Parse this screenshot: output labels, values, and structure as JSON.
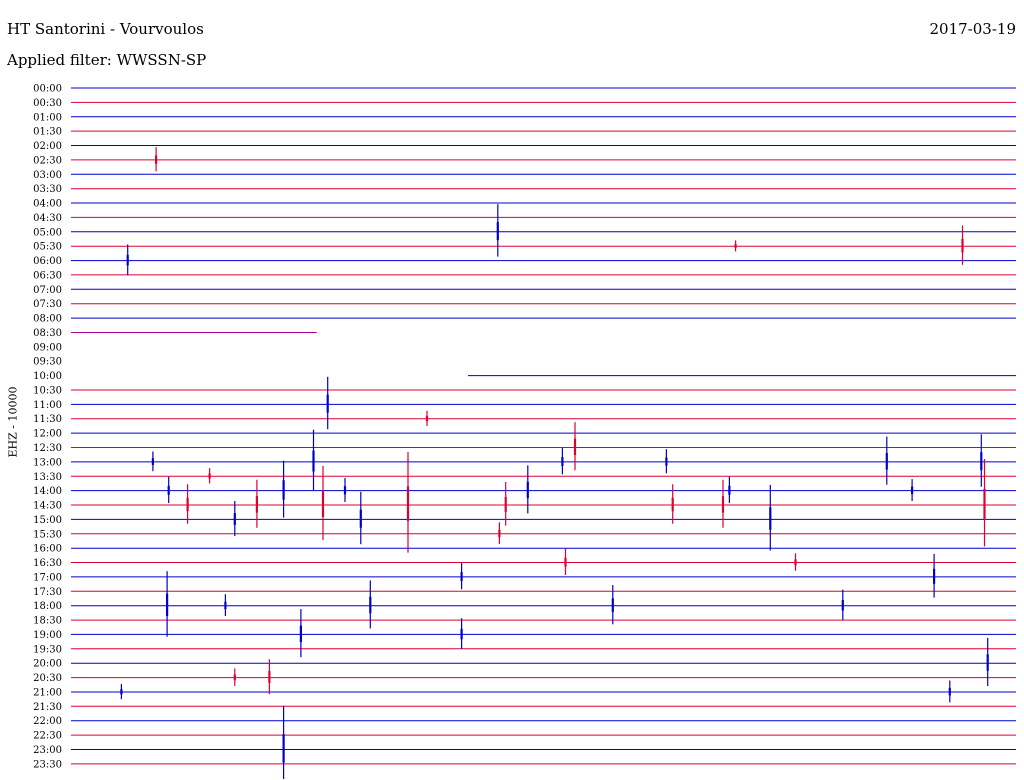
{
  "header": {
    "title": "HT Santorini - Vourvoulos",
    "date": "2017-03-19",
    "filter": "Applied filter: WWSSN-SP",
    "channel_label": "EHZ - 10000"
  },
  "colors": {
    "line_a": "#0000cc",
    "line_b": "#dd0033"
  },
  "chart_data": {
    "type": "line",
    "title": "HT Santorini - Vourvoulos",
    "subtitle": "Applied filter: WWSSN-SP",
    "ylabel": "EHZ - 10000",
    "xlabel": "",
    "y_ticks": [
      "00:00",
      "00:30",
      "01:00",
      "01:30",
      "02:00",
      "02:30",
      "03:00",
      "03:30",
      "04:00",
      "04:30",
      "05:00",
      "05:30",
      "06:00",
      "06:30",
      "07:00",
      "07:30",
      "08:00",
      "08:30",
      "09:00",
      "09:30",
      "10:00",
      "10:30",
      "11:00",
      "11:30",
      "12:00",
      "12:30",
      "13:00",
      "13:30",
      "14:00",
      "14:30",
      "15:00",
      "15:30",
      "16:00",
      "16:30",
      "17:00",
      "17:30",
      "18:00",
      "18:30",
      "19:00",
      "19:30",
      "20:00",
      "20:30",
      "21:00",
      "21:30",
      "22:00",
      "22:30",
      "23:00",
      "23:30"
    ],
    "x_range_minutes": [
      0,
      30
    ],
    "grid": false,
    "legend": "none",
    "gap": {
      "from_row": "08:30",
      "from_minute": 7.8,
      "to_row": "10:00",
      "to_minute": 12.6
    },
    "events": [
      {
        "row": "02:30",
        "t": 2.7,
        "a": 0.55
      },
      {
        "row": "05:00",
        "t": 13.55,
        "a": 1.2
      },
      {
        "row": "05:30",
        "t": 21.1,
        "a": 0.25
      },
      {
        "row": "05:30",
        "t": 28.3,
        "a": 0.9
      },
      {
        "row": "06:00",
        "t": 1.8,
        "a": 0.7
      },
      {
        "row": "11:00",
        "t": 8.15,
        "a": 1.2
      },
      {
        "row": "11:30",
        "t": 11.3,
        "a": 0.35
      },
      {
        "row": "12:30",
        "t": 16.0,
        "a": 1.1
      },
      {
        "row": "13:00",
        "t": 2.6,
        "a": 0.45
      },
      {
        "row": "13:00",
        "t": 7.7,
        "a": 1.4
      },
      {
        "row": "13:00",
        "t": 15.6,
        "a": 0.6
      },
      {
        "row": "13:00",
        "t": 18.9,
        "a": 0.55
      },
      {
        "row": "13:00",
        "t": 25.9,
        "a": 1.1
      },
      {
        "row": "13:00",
        "t": 28.9,
        "a": 1.2
      },
      {
        "row": "13:30",
        "t": 4.4,
        "a": 0.35
      },
      {
        "row": "14:00",
        "t": 3.1,
        "a": 0.6
      },
      {
        "row": "14:00",
        "t": 6.75,
        "a": 1.3
      },
      {
        "row": "14:00",
        "t": 8.7,
        "a": 0.55
      },
      {
        "row": "14:00",
        "t": 14.5,
        "a": 1.1
      },
      {
        "row": "14:00",
        "t": 20.9,
        "a": 0.6
      },
      {
        "row": "14:00",
        "t": 26.7,
        "a": 0.5
      },
      {
        "row": "14:30",
        "t": 3.7,
        "a": 0.9
      },
      {
        "row": "14:30",
        "t": 5.9,
        "a": 1.1
      },
      {
        "row": "14:30",
        "t": 8.0,
        "a": 1.7
      },
      {
        "row": "14:30",
        "t": 10.7,
        "a": 2.3
      },
      {
        "row": "14:30",
        "t": 13.8,
        "a": 1.0
      },
      {
        "row": "14:30",
        "t": 19.1,
        "a": 0.9
      },
      {
        "row": "14:30",
        "t": 20.7,
        "a": 1.1
      },
      {
        "row": "14:30",
        "t": 29.0,
        "a": 2.0
      },
      {
        "row": "15:00",
        "t": 5.2,
        "a": 0.8
      },
      {
        "row": "15:00",
        "t": 9.2,
        "a": 1.2
      },
      {
        "row": "15:00",
        "t": 22.2,
        "a": 1.5
      },
      {
        "row": "15:30",
        "t": 13.6,
        "a": 0.5
      },
      {
        "row": "16:30",
        "t": 15.7,
        "a": 0.6
      },
      {
        "row": "16:30",
        "t": 23.0,
        "a": 0.4
      },
      {
        "row": "17:00",
        "t": 12.4,
        "a": 0.6
      },
      {
        "row": "17:00",
        "t": 27.4,
        "a": 1.0
      },
      {
        "row": "18:00",
        "t": 3.05,
        "a": 1.5
      },
      {
        "row": "18:00",
        "t": 4.9,
        "a": 0.5
      },
      {
        "row": "18:00",
        "t": 9.5,
        "a": 1.1
      },
      {
        "row": "18:00",
        "t": 17.2,
        "a": 0.9
      },
      {
        "row": "18:00",
        "t": 24.5,
        "a": 0.7
      },
      {
        "row": "19:00",
        "t": 7.3,
        "a": 1.1
      },
      {
        "row": "19:00",
        "t": 12.4,
        "a": 0.7
      },
      {
        "row": "20:00",
        "t": 29.1,
        "a": 1.1
      },
      {
        "row": "20:30",
        "t": 5.2,
        "a": 0.4
      },
      {
        "row": "20:30",
        "t": 6.3,
        "a": 0.8
      },
      {
        "row": "21:00",
        "t": 1.6,
        "a": 0.35
      },
      {
        "row": "21:00",
        "t": 27.9,
        "a": 0.5
      },
      {
        "row": "23:00",
        "t": 6.75,
        "a": 1.9
      }
    ]
  }
}
